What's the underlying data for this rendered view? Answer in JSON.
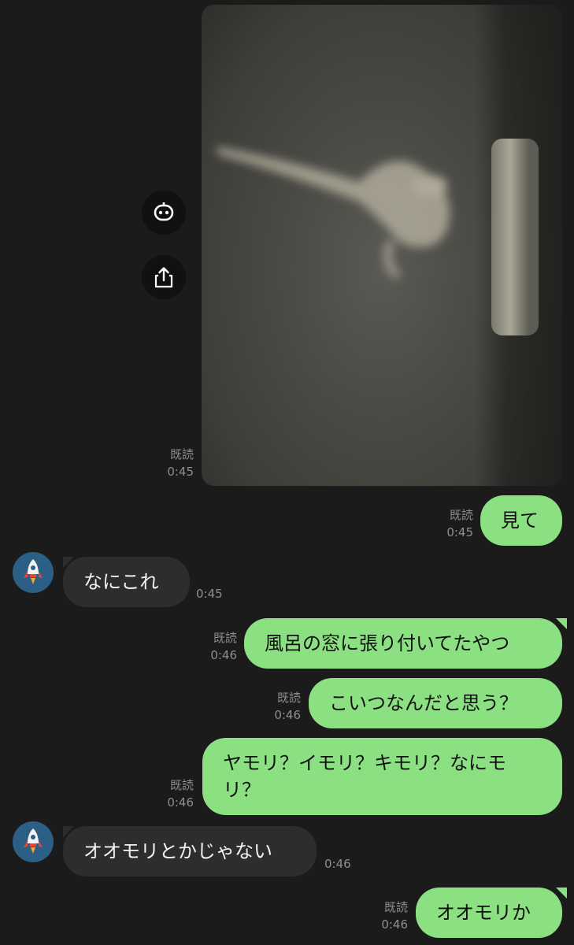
{
  "messages": [
    {
      "id": "m1",
      "type": "image",
      "direction": "out",
      "read": "既読",
      "time": "0:45"
    },
    {
      "id": "m2",
      "type": "text",
      "direction": "out",
      "text": "見て",
      "read": "既読",
      "time": "0:45"
    },
    {
      "id": "m3",
      "type": "text",
      "direction": "in",
      "text": "なにこれ",
      "time": "0:45"
    },
    {
      "id": "m4",
      "type": "text",
      "direction": "out",
      "text": "風呂の窓に張り付いてたやつ",
      "read": "既読",
      "time": "0:46"
    },
    {
      "id": "m5",
      "type": "text",
      "direction": "out",
      "text": "こいつなんだと思う？",
      "read": "既読",
      "time": "0:46"
    },
    {
      "id": "m6",
      "type": "text",
      "direction": "out",
      "text_line1": "ヤモリ？イモリ？キモリ？なにモ",
      "text_line2": "リ？",
      "read": "既読",
      "time": "0:46"
    },
    {
      "id": "m7",
      "type": "text",
      "direction": "in",
      "text": "オオモリとかじゃない",
      "time": "0:46"
    },
    {
      "id": "m8",
      "type": "text",
      "direction": "out",
      "text": "オオモリか",
      "read": "既読",
      "time": "0:46"
    }
  ],
  "image_actions": [
    {
      "icon": "bot-face-icon"
    },
    {
      "icon": "share-icon"
    }
  ],
  "colors": {
    "background": "#1b1b1c",
    "outgoing_bubble": "#8be082",
    "incoming_bubble": "#2d2d2e",
    "meta_text": "#8e8e8e",
    "avatar_bg": "#2b5f86"
  }
}
